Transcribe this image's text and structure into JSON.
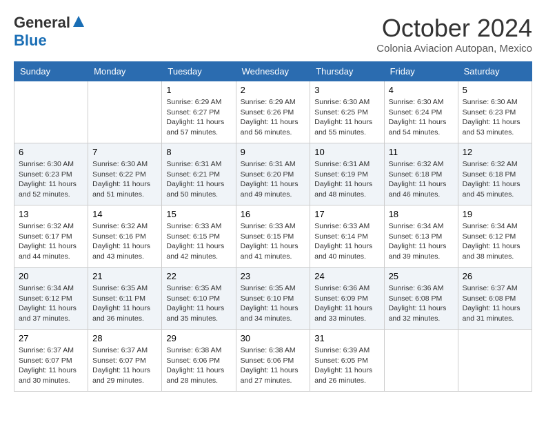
{
  "header": {
    "logo_general": "General",
    "logo_blue": "Blue",
    "month_title": "October 2024",
    "subtitle": "Colonia Aviacion Autopan, Mexico"
  },
  "days_of_week": [
    "Sunday",
    "Monday",
    "Tuesday",
    "Wednesday",
    "Thursday",
    "Friday",
    "Saturday"
  ],
  "weeks": [
    [
      {
        "day": "",
        "sunrise": "",
        "sunset": "",
        "daylight": ""
      },
      {
        "day": "",
        "sunrise": "",
        "sunset": "",
        "daylight": ""
      },
      {
        "day": "1",
        "sunrise": "Sunrise: 6:29 AM",
        "sunset": "Sunset: 6:27 PM",
        "daylight": "Daylight: 11 hours and 57 minutes."
      },
      {
        "day": "2",
        "sunrise": "Sunrise: 6:29 AM",
        "sunset": "Sunset: 6:26 PM",
        "daylight": "Daylight: 11 hours and 56 minutes."
      },
      {
        "day": "3",
        "sunrise": "Sunrise: 6:30 AM",
        "sunset": "Sunset: 6:25 PM",
        "daylight": "Daylight: 11 hours and 55 minutes."
      },
      {
        "day": "4",
        "sunrise": "Sunrise: 6:30 AM",
        "sunset": "Sunset: 6:24 PM",
        "daylight": "Daylight: 11 hours and 54 minutes."
      },
      {
        "day": "5",
        "sunrise": "Sunrise: 6:30 AM",
        "sunset": "Sunset: 6:23 PM",
        "daylight": "Daylight: 11 hours and 53 minutes."
      }
    ],
    [
      {
        "day": "6",
        "sunrise": "Sunrise: 6:30 AM",
        "sunset": "Sunset: 6:23 PM",
        "daylight": "Daylight: 11 hours and 52 minutes."
      },
      {
        "day": "7",
        "sunrise": "Sunrise: 6:30 AM",
        "sunset": "Sunset: 6:22 PM",
        "daylight": "Daylight: 11 hours and 51 minutes."
      },
      {
        "day": "8",
        "sunrise": "Sunrise: 6:31 AM",
        "sunset": "Sunset: 6:21 PM",
        "daylight": "Daylight: 11 hours and 50 minutes."
      },
      {
        "day": "9",
        "sunrise": "Sunrise: 6:31 AM",
        "sunset": "Sunset: 6:20 PM",
        "daylight": "Daylight: 11 hours and 49 minutes."
      },
      {
        "day": "10",
        "sunrise": "Sunrise: 6:31 AM",
        "sunset": "Sunset: 6:19 PM",
        "daylight": "Daylight: 11 hours and 48 minutes."
      },
      {
        "day": "11",
        "sunrise": "Sunrise: 6:32 AM",
        "sunset": "Sunset: 6:18 PM",
        "daylight": "Daylight: 11 hours and 46 minutes."
      },
      {
        "day": "12",
        "sunrise": "Sunrise: 6:32 AM",
        "sunset": "Sunset: 6:18 PM",
        "daylight": "Daylight: 11 hours and 45 minutes."
      }
    ],
    [
      {
        "day": "13",
        "sunrise": "Sunrise: 6:32 AM",
        "sunset": "Sunset: 6:17 PM",
        "daylight": "Daylight: 11 hours and 44 minutes."
      },
      {
        "day": "14",
        "sunrise": "Sunrise: 6:32 AM",
        "sunset": "Sunset: 6:16 PM",
        "daylight": "Daylight: 11 hours and 43 minutes."
      },
      {
        "day": "15",
        "sunrise": "Sunrise: 6:33 AM",
        "sunset": "Sunset: 6:15 PM",
        "daylight": "Daylight: 11 hours and 42 minutes."
      },
      {
        "day": "16",
        "sunrise": "Sunrise: 6:33 AM",
        "sunset": "Sunset: 6:15 PM",
        "daylight": "Daylight: 11 hours and 41 minutes."
      },
      {
        "day": "17",
        "sunrise": "Sunrise: 6:33 AM",
        "sunset": "Sunset: 6:14 PM",
        "daylight": "Daylight: 11 hours and 40 minutes."
      },
      {
        "day": "18",
        "sunrise": "Sunrise: 6:34 AM",
        "sunset": "Sunset: 6:13 PM",
        "daylight": "Daylight: 11 hours and 39 minutes."
      },
      {
        "day": "19",
        "sunrise": "Sunrise: 6:34 AM",
        "sunset": "Sunset: 6:12 PM",
        "daylight": "Daylight: 11 hours and 38 minutes."
      }
    ],
    [
      {
        "day": "20",
        "sunrise": "Sunrise: 6:34 AM",
        "sunset": "Sunset: 6:12 PM",
        "daylight": "Daylight: 11 hours and 37 minutes."
      },
      {
        "day": "21",
        "sunrise": "Sunrise: 6:35 AM",
        "sunset": "Sunset: 6:11 PM",
        "daylight": "Daylight: 11 hours and 36 minutes."
      },
      {
        "day": "22",
        "sunrise": "Sunrise: 6:35 AM",
        "sunset": "Sunset: 6:10 PM",
        "daylight": "Daylight: 11 hours and 35 minutes."
      },
      {
        "day": "23",
        "sunrise": "Sunrise: 6:35 AM",
        "sunset": "Sunset: 6:10 PM",
        "daylight": "Daylight: 11 hours and 34 minutes."
      },
      {
        "day": "24",
        "sunrise": "Sunrise: 6:36 AM",
        "sunset": "Sunset: 6:09 PM",
        "daylight": "Daylight: 11 hours and 33 minutes."
      },
      {
        "day": "25",
        "sunrise": "Sunrise: 6:36 AM",
        "sunset": "Sunset: 6:08 PM",
        "daylight": "Daylight: 11 hours and 32 minutes."
      },
      {
        "day": "26",
        "sunrise": "Sunrise: 6:37 AM",
        "sunset": "Sunset: 6:08 PM",
        "daylight": "Daylight: 11 hours and 31 minutes."
      }
    ],
    [
      {
        "day": "27",
        "sunrise": "Sunrise: 6:37 AM",
        "sunset": "Sunset: 6:07 PM",
        "daylight": "Daylight: 11 hours and 30 minutes."
      },
      {
        "day": "28",
        "sunrise": "Sunrise: 6:37 AM",
        "sunset": "Sunset: 6:07 PM",
        "daylight": "Daylight: 11 hours and 29 minutes."
      },
      {
        "day": "29",
        "sunrise": "Sunrise: 6:38 AM",
        "sunset": "Sunset: 6:06 PM",
        "daylight": "Daylight: 11 hours and 28 minutes."
      },
      {
        "day": "30",
        "sunrise": "Sunrise: 6:38 AM",
        "sunset": "Sunset: 6:06 PM",
        "daylight": "Daylight: 11 hours and 27 minutes."
      },
      {
        "day": "31",
        "sunrise": "Sunrise: 6:39 AM",
        "sunset": "Sunset: 6:05 PM",
        "daylight": "Daylight: 11 hours and 26 minutes."
      },
      {
        "day": "",
        "sunrise": "",
        "sunset": "",
        "daylight": ""
      },
      {
        "day": "",
        "sunrise": "",
        "sunset": "",
        "daylight": ""
      }
    ]
  ]
}
